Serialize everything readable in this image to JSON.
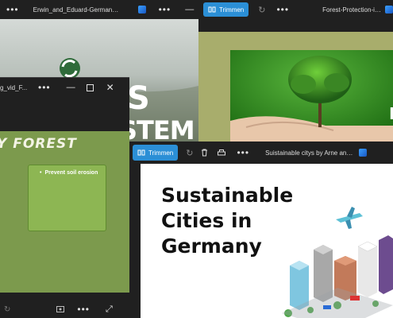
{
  "window_a": {
    "title": "Erwin_and_Eduard-Germany's_...",
    "slide_letters_1": "S",
    "slide_letters_2": "STEM"
  },
  "window_b": {
    "trim_label": "Trimmen",
    "title": "Forest-Protection-in-Germany..."
  },
  "window_c": {
    "title": "g_vid_F...",
    "heading": "Y FOREST",
    "bullet": "Prevent soil erosion"
  },
  "window_d": {
    "trim_label": "Trimmen",
    "title": "Suistainable citys by Arne and S...",
    "heading_line1": "Sustainable",
    "heading_line2": "Cities in",
    "heading_line3": "Germany"
  },
  "colors": {
    "accent": "#2b8fd6",
    "titlebar": "#202020",
    "forest_green": "#7c9a4d",
    "olive": "#a8ad6c"
  },
  "icons": [
    "more-icon",
    "image-icon",
    "trim-icon",
    "rotate-icon",
    "delete-icon",
    "print-icon",
    "minimize-icon",
    "maximize-icon",
    "close-icon",
    "expand-icon"
  ]
}
